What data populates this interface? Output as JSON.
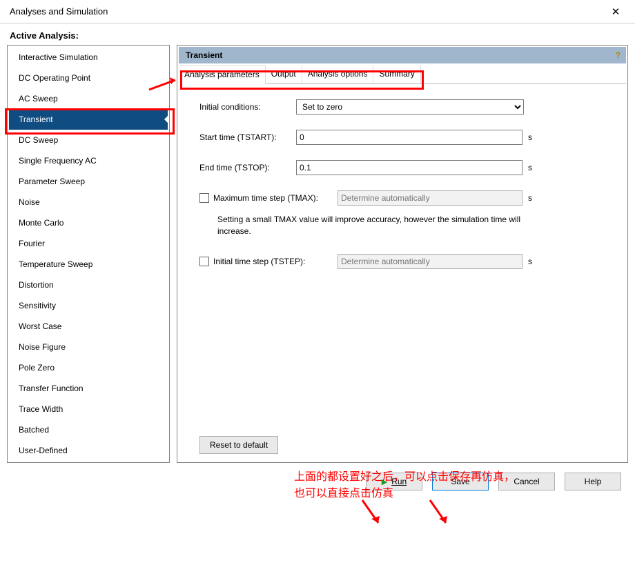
{
  "window": {
    "title": "Analyses and Simulation"
  },
  "section_label": "Active Analysis:",
  "sidebar": {
    "items": [
      {
        "label": "Interactive Simulation"
      },
      {
        "label": "DC Operating Point"
      },
      {
        "label": "AC Sweep"
      },
      {
        "label": "Transient"
      },
      {
        "label": "DC Sweep"
      },
      {
        "label": "Single Frequency AC"
      },
      {
        "label": "Parameter Sweep"
      },
      {
        "label": "Noise"
      },
      {
        "label": "Monte Carlo"
      },
      {
        "label": "Fourier"
      },
      {
        "label": "Temperature Sweep"
      },
      {
        "label": "Distortion"
      },
      {
        "label": "Sensitivity"
      },
      {
        "label": "Worst Case"
      },
      {
        "label": "Noise Figure"
      },
      {
        "label": "Pole Zero"
      },
      {
        "label": "Transfer Function"
      },
      {
        "label": "Trace Width"
      },
      {
        "label": "Batched"
      },
      {
        "label": "User-Defined"
      }
    ],
    "selected_index": 3
  },
  "panel": {
    "title": "Transient"
  },
  "tabs": [
    {
      "label": "Analysis parameters"
    },
    {
      "label": "Output"
    },
    {
      "label": "Analysis options"
    },
    {
      "label": "Summary"
    }
  ],
  "form": {
    "initial_conditions": {
      "label": "Initial conditions:",
      "value": "Set to zero"
    },
    "start_time": {
      "label": "Start time (TSTART):",
      "value": "0",
      "unit": "s"
    },
    "end_time": {
      "label": "End time (TSTOP):",
      "value": "0.1",
      "unit": "s"
    },
    "max_step": {
      "label": "Maximum time step (TMAX):",
      "value": "",
      "placeholder": "Determine automatically",
      "unit": "s",
      "checked": false
    },
    "hint": "Setting a small TMAX value will improve accuracy, however the simulation time will increase.",
    "init_step": {
      "label": "Initial time step (TSTEP):",
      "value": "",
      "placeholder": "Determine automatically",
      "unit": "s",
      "checked": false
    },
    "reset_label": "Reset to default"
  },
  "footer": {
    "run": "Run",
    "save": "Save",
    "cancel": "Cancel",
    "help": "Help"
  },
  "annotation": {
    "text": "上面的都设置好之后，可以点击保存再仿真，\n也可以直接点击仿真"
  }
}
